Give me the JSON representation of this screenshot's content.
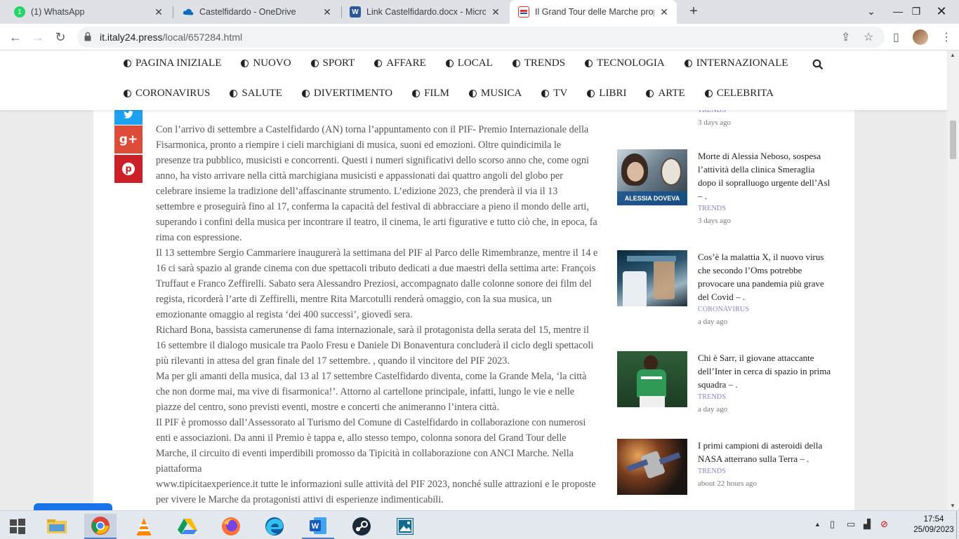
{
  "browser": {
    "tabs": [
      {
        "title": "(1) WhatsApp",
        "active": false,
        "icon": "whatsapp-icon"
      },
      {
        "title": "Castelfidardo - OneDrive",
        "active": false,
        "icon": "onedrive-icon"
      },
      {
        "title": "Link Castelfidardo.docx - Microsof",
        "active": false,
        "icon": "word-icon"
      },
      {
        "title": "Il Grand Tour delle Marche propo",
        "active": true,
        "icon": "news-favicon"
      }
    ],
    "url_host": "it.italy24.press",
    "url_path": "/local/657284.html"
  },
  "nav": {
    "row1": [
      "PAGINA INIZIALE",
      "NUOVO",
      "SPORT",
      "AFFARE",
      "LOCAL",
      "TRENDS",
      "TECNOLOGIA",
      "INTERNAZIONALE"
    ],
    "row2": [
      "CORONAVIRUS",
      "SALUTE",
      "DIVERTIMENTO",
      "FILM",
      "MUSICA",
      "TV",
      "LIBRI",
      "ARTE",
      "CELEBRITA"
    ]
  },
  "share": {
    "gplus": "g+",
    "pinterest": "p"
  },
  "article": {
    "paragraphs": [
      "Con l’arrivo di settembre a Castelfidardo (AN) torna l’appuntamento con il PIF- Premio Internazionale della Fisarmonica, pronto a riempire i cieli marchigiani di musica, suoni ed emozioni. Oltre quindicimila le presenze tra pubblico, musicisti e concorrenti. Questi i numeri significativi dello scorso anno che, come ogni anno, ha visto arrivare nella città marchigiana musicisti e appassionati dai quattro angoli del globo per celebrare insieme la tradizione dell’affascinante strumento. L’edizione 2023, che prenderà il via il 13 settembre e proseguirà fino al 17, conferma la capacità del festival di abbracciare a pieno il mondo delle arti, superando i confini della musica per incontrare il teatro, il cinema, le arti figurative e tutto ciò che, in epoca, fa rima con espressione.",
      "Il 13 settembre Sergio Cammariere inaugurerà la settimana del PIF al Parco delle Rimembranze, mentre il 14 e 16 ci sarà spazio al grande cinema con due spettacoli tributo dedicati a due maestri della settima arte: François Truffaut e Franco Zeffirelli. Sabato sera Alessandro Preziosi, accompagnato dalle colonne sonore dei film del regista, ricorderà l’arte di Zeffirelli, mentre Rita Marcotulli renderà omaggio, con la sua musica, un emozionante omaggio al regista ‘dei 400 successi’, giovedì sera.",
      "Richard Bona, bassista camerunense di fama internazionale, sarà il protagonista della serata del 15, mentre il 16 settembre il dialogo musicale tra Paolo Fresu e Daniele Di Bonaventura concluderà il ciclo degli spettacoli più rilevanti in attesa del gran finale del 17 settembre. , quando il vincitore del PIF 2023.",
      "Ma per gli amanti della musica, dal 13 al 17 settembre Castelfidardo diventa, come la Grande Mela, ‘la città che non dorme mai, ma vive di fisarmonica!’. Attorno al cartellone principale, infatti, lungo le vie e nelle piazze del centro, sono previsti eventi, mostre e concerti che animeranno l’intera città.",
      "Il PIF è promosso dall’Assessorato al Turismo del Comune di Castelfidardo in collaborazione con numerosi enti e associazioni. Da anni il Premio è tappa e, allo stesso tempo, colonna sonora del Grand Tour delle Marche, il circuito di eventi imperdibili promosso da Tipicità in collaborazione con ANCI Marche. Nella piattaforma",
      "www.tipicitaexperience.it tutte le informazioni sulle attività del PIF 2023, nonché sulle attrazioni e le proposte per vivere le Marche da protagonisti attivi di esperienze indimenticabili."
    ]
  },
  "sidebar": {
    "top_partial": {
      "category": "TRENDS",
      "time": "3 days ago"
    },
    "items": [
      {
        "title": "Morte di Alessia Neboso, sospesa l’attività della clinica Smeraglia dopo il sopralluogo urgente dell’Asl – .",
        "category": "TRENDS",
        "time": "3 days ago",
        "thumb_caption": "ALESSIA DOVEVA SPOSARSI"
      },
      {
        "title": "Cos’è la malattia X, il nuovo virus che secondo l’Oms potrebbe provocare una pandemia più grave del Covid – .",
        "category": "CORONAVIRUS",
        "time": "a day ago"
      },
      {
        "title": "Chi è Sarr, il giovane attaccante dell’Inter in cerca di spazio in prima squadra – .",
        "category": "TRENDS",
        "time": "a day ago"
      },
      {
        "title": "I primi campioni di asteroidi della NASA atterrano sulla Terra – .",
        "category": "TRENDS",
        "time": "about 22 hours ago"
      }
    ]
  },
  "taskbar": {
    "time": "17:54",
    "date": "25/09/2023"
  }
}
